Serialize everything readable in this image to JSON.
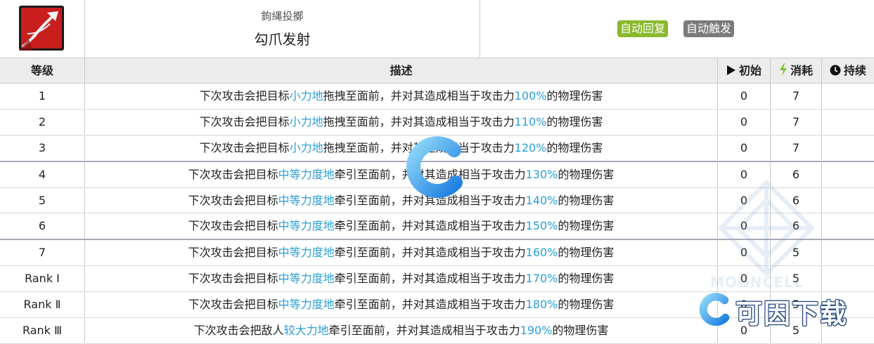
{
  "skill": {
    "icon": "grappling-hook-icon",
    "name_original": "鉤縄投擲",
    "name": "勾爪发射",
    "tags": [
      {
        "label": "自动回复",
        "color": "#8ab92d"
      },
      {
        "label": "自动触发",
        "color": "#7b7b7b"
      }
    ]
  },
  "columns": {
    "level": "等级",
    "description": "描述",
    "initial": "初始",
    "cost": "消耗",
    "duration": "持续"
  },
  "rows": [
    {
      "level": "1",
      "pre": "下次攻击会把目标",
      "force": "小力地",
      "mid": "拖拽至面前，并对其造成相当于攻击力",
      "pct": "100%",
      "post": "的物理伤害",
      "initial": "0",
      "cost": "7",
      "duration": ""
    },
    {
      "level": "2",
      "pre": "下次攻击会把目标",
      "force": "小力地",
      "mid": "拖拽至面前，并对其造成相当于攻击力",
      "pct": "110%",
      "post": "的物理伤害",
      "initial": "0",
      "cost": "7",
      "duration": ""
    },
    {
      "level": "3",
      "pre": "下次攻击会把目标",
      "force": "小力地",
      "mid": "拖拽至面前，并对其造成相当于攻击力",
      "pct": "120%",
      "post": "的物理伤害",
      "initial": "0",
      "cost": "7",
      "duration": ""
    },
    {
      "level": "4",
      "pre": "下次攻击会把目标",
      "force": "中等力度地",
      "mid": "牵引至面前，并对其造成相当于攻击力",
      "pct": "130%",
      "post": "的物理伤害",
      "initial": "0",
      "cost": "6",
      "duration": ""
    },
    {
      "level": "5",
      "pre": "下次攻击会把目标",
      "force": "中等力度地",
      "mid": "牵引至面前，并对其造成相当于攻击力",
      "pct": "140%",
      "post": "的物理伤害",
      "initial": "0",
      "cost": "6",
      "duration": ""
    },
    {
      "level": "6",
      "pre": "下次攻击会把目标",
      "force": "中等力度地",
      "mid": "牵引至面前，并对其造成相当于攻击力",
      "pct": "150%",
      "post": "的物理伤害",
      "initial": "0",
      "cost": "6",
      "duration": ""
    },
    {
      "level": "7",
      "pre": "下次攻击会把目标",
      "force": "中等力度地",
      "mid": "牵引至面前，并对其造成相当于攻击力",
      "pct": "160%",
      "post": "的物理伤害",
      "initial": "0",
      "cost": "5",
      "duration": ""
    },
    {
      "level": "Rank Ⅰ",
      "pre": "下次攻击会把目标",
      "force": "中等力度地",
      "mid": "牵引至面前，并对其造成相当于攻击力",
      "pct": "170%",
      "post": "的物理伤害",
      "initial": "0",
      "cost": "5",
      "duration": ""
    },
    {
      "level": "Rank Ⅱ",
      "pre": "下次攻击会把目标",
      "force": "中等力度地",
      "mid": "牵引至面前，并对其造成相当于攻击力",
      "pct": "180%",
      "post": "的物理伤害",
      "initial": "0",
      "cost": "5",
      "duration": ""
    },
    {
      "level": "Rank Ⅲ",
      "pre": "下次攻击会把敌人",
      "force": "较大力地",
      "mid": "牵引至面前，并对其造成相当于攻击力",
      "pct": "190%",
      "post": "的物理伤害",
      "initial": "0",
      "cost": "5",
      "duration": ""
    }
  ],
  "watermark": {
    "brand": "可因下载",
    "faint": "MOONCELL"
  },
  "colors": {
    "highlight": "#2b9fd6",
    "header_bg": "#ececec",
    "cost_icon": "#7ec03a"
  }
}
